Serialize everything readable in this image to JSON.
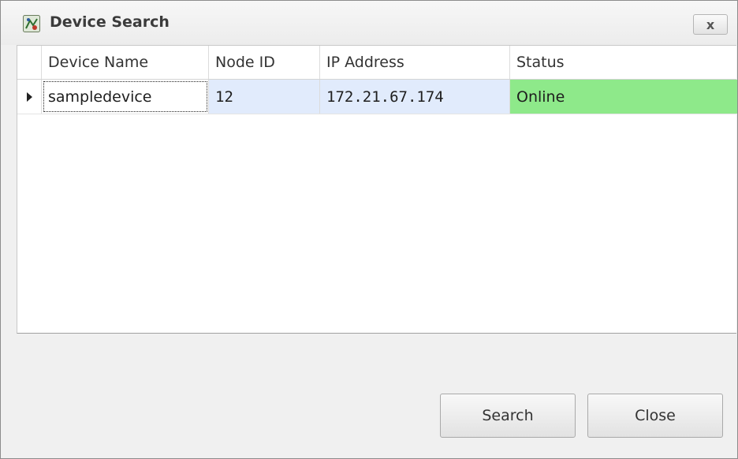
{
  "window": {
    "title": "Device Search",
    "close_glyph": "x",
    "app_icon": "device-search-app-icon"
  },
  "grid": {
    "columns": [
      "Device Name",
      "Node ID",
      "IP Address",
      "Status"
    ],
    "rows": [
      {
        "device_name": "sampledevice",
        "node_id": "12",
        "ip_address": "172.21.67.174",
        "status": "Online",
        "selected": true
      }
    ],
    "status_online_color": "#8ee98a",
    "selected_row_color": "#e1ebfc"
  },
  "buttons": {
    "search_label": "Search",
    "close_label": "Close"
  }
}
